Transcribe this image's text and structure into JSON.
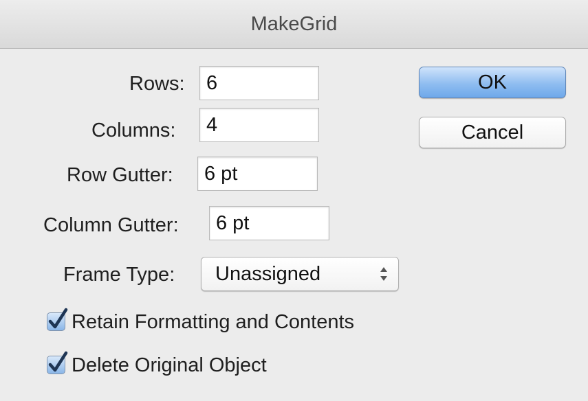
{
  "window": {
    "title": "MakeGrid"
  },
  "form": {
    "rows": {
      "label": "Rows:",
      "value": "6"
    },
    "columns": {
      "label": "Columns:",
      "value": "4"
    },
    "row_gutter": {
      "label": "Row Gutter:",
      "value": "6 pt"
    },
    "column_gutter": {
      "label": "Column Gutter:",
      "value": "6 pt"
    },
    "frame_type": {
      "label": "Frame Type:",
      "value": "Unassigned"
    }
  },
  "buttons": {
    "ok_label": "OK",
    "cancel_label": "Cancel"
  },
  "options": {
    "retain_formatting": {
      "label": "Retain Formatting and Contents",
      "checked": true
    },
    "delete_original": {
      "label": "Delete Original Object",
      "checked": true
    }
  },
  "colors": {
    "default_button": "#8fbdf0",
    "checkbox_fill": "#8ab6e8",
    "checkmark": "#1e3554"
  },
  "icons": {
    "select_arrows": "up-down-chevron-icon",
    "check": "checkmark-icon"
  }
}
